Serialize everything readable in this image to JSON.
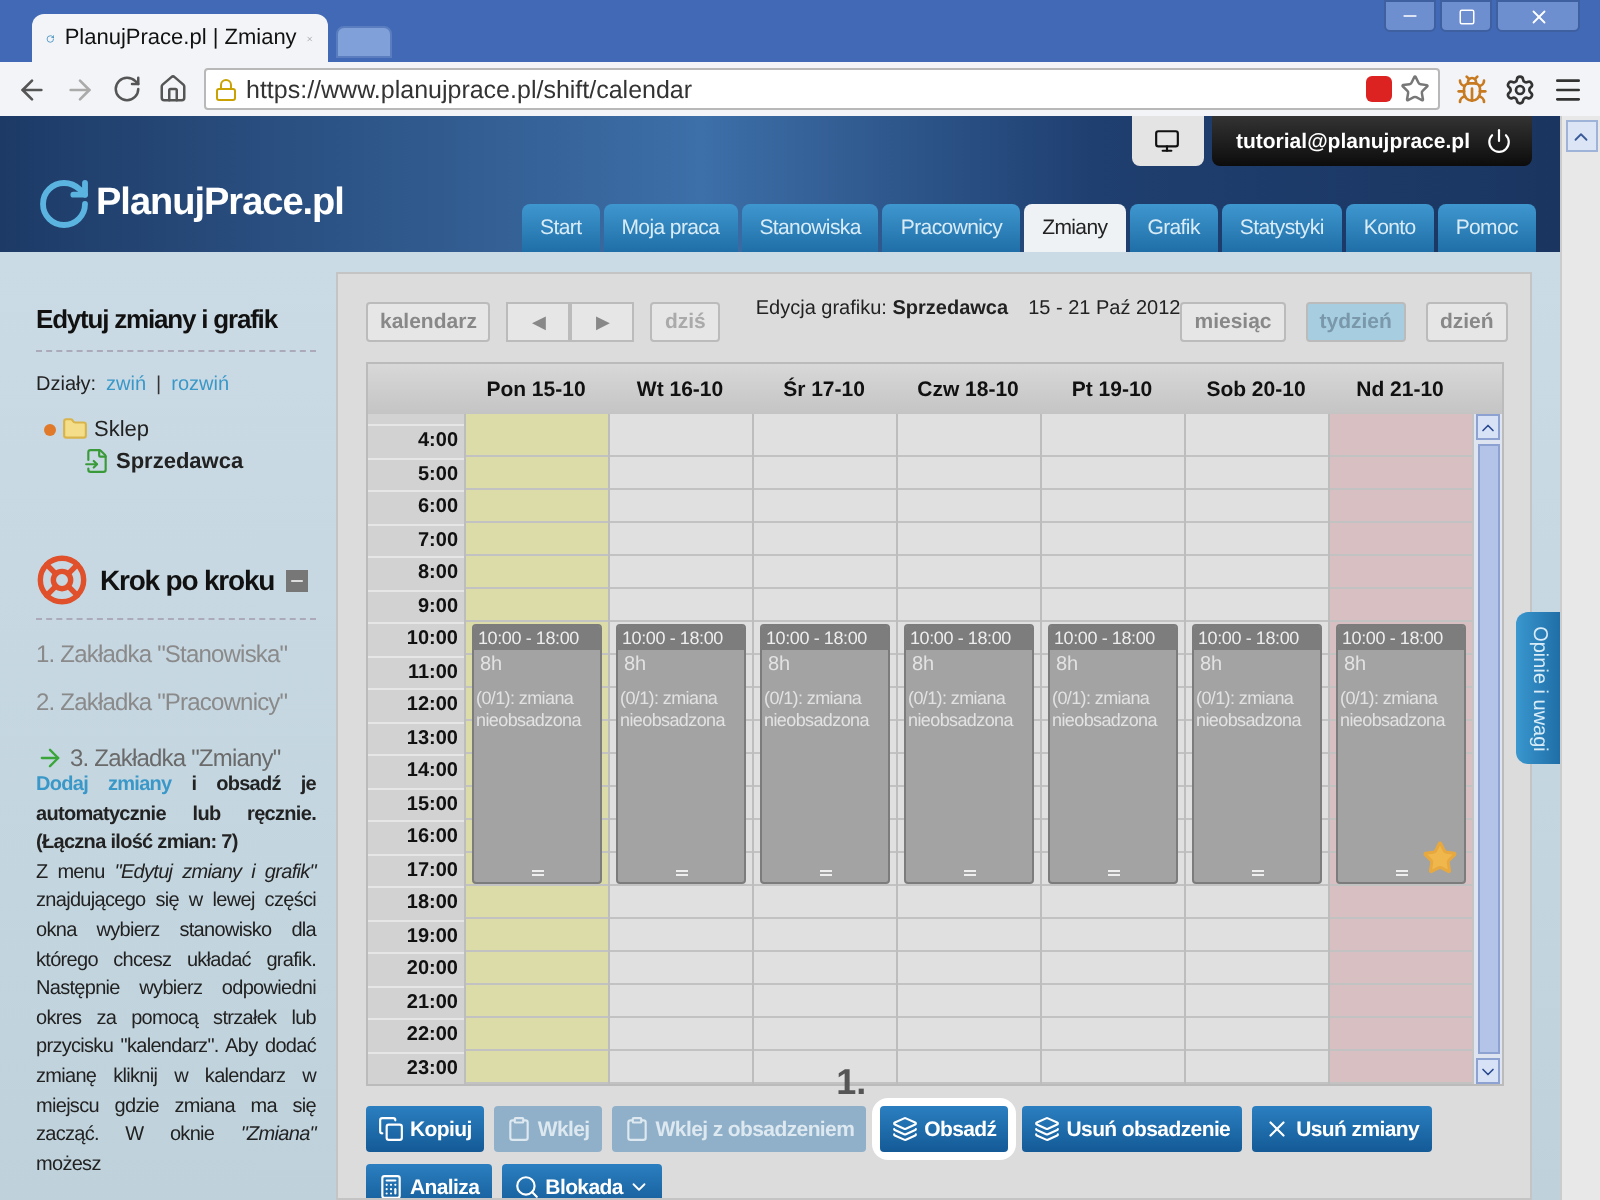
{
  "browser": {
    "tab_title": "PlanujPrace.pl | Zmiany",
    "url": "https://www.planujprace.pl/shift/calendar"
  },
  "header": {
    "logo": "PlanujPrace.pl",
    "user_email": "tutorial@planujprace.pl",
    "nav": [
      {
        "label": "Start",
        "selected": false
      },
      {
        "label": "Moja praca",
        "selected": false
      },
      {
        "label": "Stanowiska",
        "selected": false
      },
      {
        "label": "Pracownicy",
        "selected": false
      },
      {
        "label": "Zmiany",
        "selected": true
      },
      {
        "label": "Grafik",
        "selected": false
      },
      {
        "label": "Statystyki",
        "selected": false
      },
      {
        "label": "Konto",
        "selected": false
      },
      {
        "label": "Pomoc",
        "selected": false
      }
    ]
  },
  "sidebar": {
    "title": "Edytuj zmiany i grafik",
    "departments_label": "Działy:",
    "links": [
      "zwiń",
      "rozwiń"
    ],
    "separator": "|",
    "tree": [
      {
        "label": "Sklep",
        "expanded": true,
        "children": [
          {
            "label": "Sprzedawca",
            "selected": true
          }
        ]
      }
    ],
    "guide": {
      "title": "Krok po kroku",
      "steps": [
        {
          "text": "1. Zakładka \"Stanowiska\"",
          "current": false
        },
        {
          "text": "2. Zakładka \"Pracownicy\"",
          "current": false
        },
        {
          "text": "3. Zakładka \"Zmiany\"",
          "current": true
        }
      ],
      "action_link": "Dodaj zmiany",
      "action_text": "i obsadź je automatycznie lub ręcznie. (Łączna ilość zmian: 7)",
      "description": "Z menu *\"Edytuj zmiany i grafik\"* znajdującego się w lewej części okna wybierz stanowisko dla którego chcesz układać grafik. Następnie wybierz odpowiedni okres za pomocą strzałek lub przycisku \"kalendarz\". Aby dodać zmianę kliknij w kalendarz w miejscu gdzie zmiana ma się zacząć. W oknie *\"Zmiana\"* możesz"
    }
  },
  "toolbar": {
    "calendar_button": "kalendarz",
    "prev": "◀",
    "next": "▶",
    "today": "dziś",
    "title": "Edycja grafiku: **Sprzedawca**",
    "range": "15 - 21 Paź 2012",
    "views": [
      {
        "label": "miesiąc",
        "selected": false
      },
      {
        "label": "tydzień",
        "selected": true
      },
      {
        "label": "dzień",
        "selected": false
      }
    ]
  },
  "calendar": {
    "days": [
      {
        "label": "Pon 15-10",
        "kind": "today",
        "shift": {
          "time": "10:00 - 18:00",
          "duration": "8h",
          "status": "(0/1): zmiana nieobsadzona",
          "starred": false
        }
      },
      {
        "label": "Wt 16-10",
        "kind": "normal",
        "shift": {
          "time": "10:00 - 18:00",
          "duration": "8h",
          "status": "(0/1): zmiana nieobsadzona",
          "starred": false
        }
      },
      {
        "label": "Śr 17-10",
        "kind": "normal",
        "shift": {
          "time": "10:00 - 18:00",
          "duration": "8h",
          "status": "(0/1): zmiana nieobsadzona",
          "starred": false
        }
      },
      {
        "label": "Czw 18-10",
        "kind": "normal",
        "shift": {
          "time": "10:00 - 18:00",
          "duration": "8h",
          "status": "(0/1): zmiana nieobsadzona",
          "starred": false
        }
      },
      {
        "label": "Pt 19-10",
        "kind": "normal",
        "shift": {
          "time": "10:00 - 18:00",
          "duration": "8h",
          "status": "(0/1): zmiana nieobsadzona",
          "starred": false
        }
      },
      {
        "label": "Sob 20-10",
        "kind": "normal",
        "shift": {
          "time": "10:00 - 18:00",
          "duration": "8h",
          "status": "(0/1): zmiana nieobsadzona",
          "starred": false
        }
      },
      {
        "label": "Nd 21-10",
        "kind": "holiday",
        "shift": {
          "time": "10:00 - 18:00",
          "duration": "8h",
          "status": "(0/1): zmiana nieobsadzona",
          "starred": true
        }
      }
    ],
    "hours": [
      "4:00",
      "5:00",
      "6:00",
      "7:00",
      "8:00",
      "9:00",
      "10:00",
      "11:00",
      "12:00",
      "13:00",
      "14:00",
      "15:00",
      "16:00",
      "17:00",
      "18:00",
      "19:00",
      "20:00",
      "21:00",
      "22:00",
      "23:00"
    ]
  },
  "actions": [
    {
      "label": "Kopiuj",
      "disabled": false,
      "highlighted": false
    },
    {
      "label": "Wklej",
      "disabled": true,
      "highlighted": false
    },
    {
      "label": "Wklej z obsadzeniem",
      "disabled": true,
      "highlighted": false
    },
    {
      "label": "Obsadź",
      "disabled": false,
      "highlighted": true
    },
    {
      "label": "Usuń obsadzenie",
      "disabled": false,
      "highlighted": false
    },
    {
      "label": "Usuń zmiany",
      "disabled": false,
      "highlighted": false
    },
    {
      "label": "Analiza",
      "disabled": false,
      "highlighted": false
    },
    {
      "label": "Blokada",
      "disabled": false,
      "highlighted": false
    }
  ],
  "annotation": "1.",
  "feedback_tab": "Opinie i uwagi"
}
